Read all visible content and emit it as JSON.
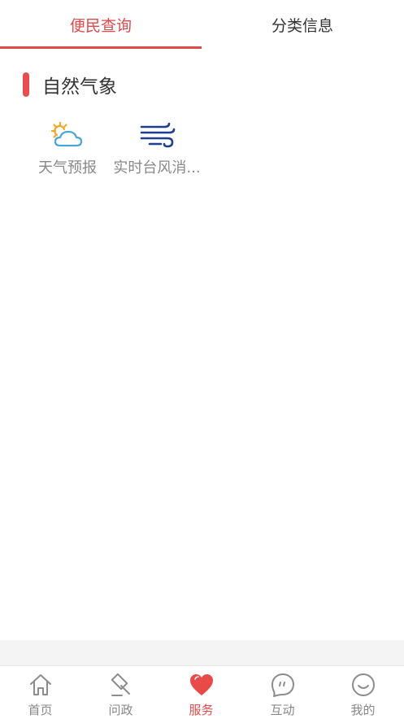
{
  "tabs": [
    {
      "label": "便民查询",
      "active": true
    },
    {
      "label": "分类信息",
      "active": false
    }
  ],
  "section": {
    "title": "自然气象"
  },
  "services": [
    {
      "label": "天气预报",
      "icon": "weather-sun-cloud-icon"
    },
    {
      "label": "实时台风消...",
      "icon": "wind-icon"
    }
  ],
  "nav": [
    {
      "label": "首页",
      "icon": "home-icon"
    },
    {
      "label": "问政",
      "icon": "gavel-icon"
    },
    {
      "label": "服务",
      "icon": "heart-icon",
      "active": true
    },
    {
      "label": "互动",
      "icon": "chat-bubble-icon"
    },
    {
      "label": "我的",
      "icon": "smile-face-icon"
    }
  ],
  "colors": {
    "accent": "#e04a4a",
    "section_bar": "#ea4d4d",
    "wind_icon": "#1f3f8f",
    "sun": "#f5a623",
    "cloud": "#4aa6d8"
  }
}
